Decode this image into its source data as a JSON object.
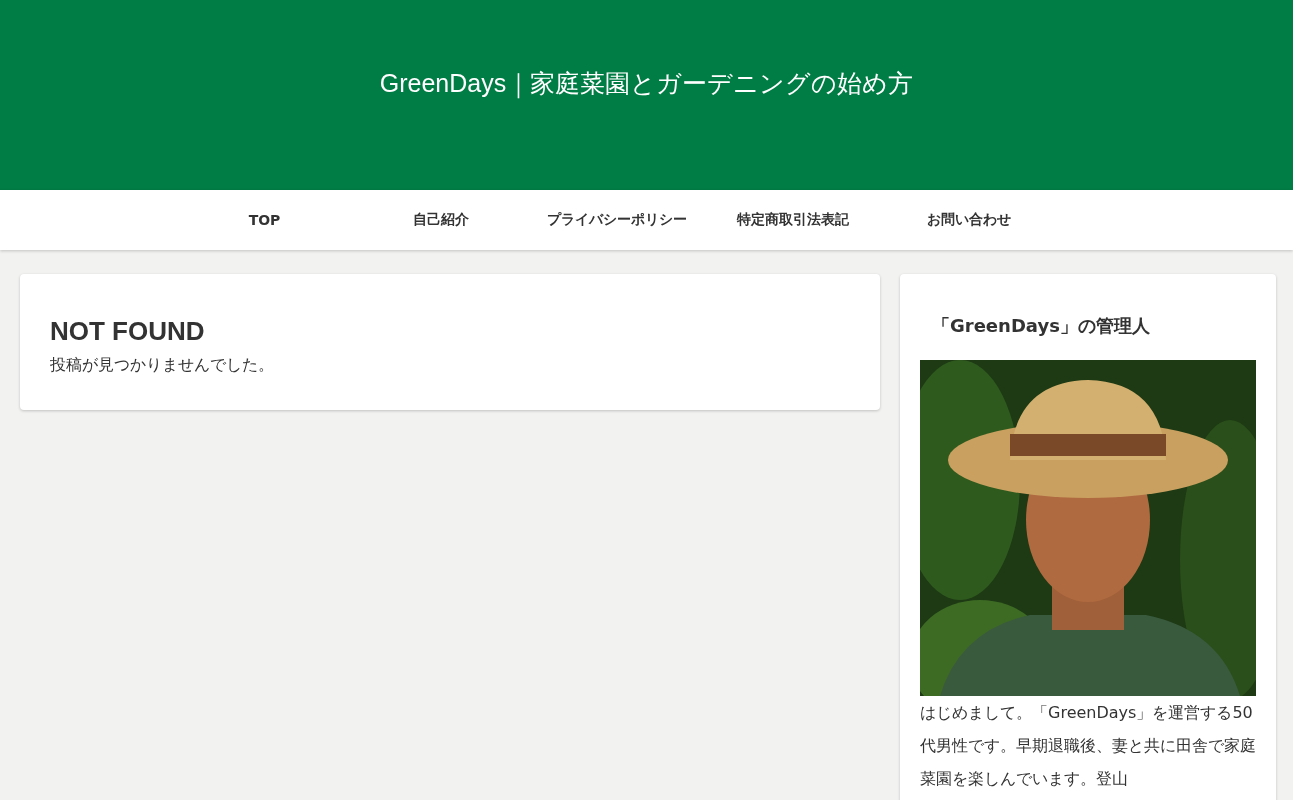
{
  "header": {
    "title": "GreenDays｜家庭菜園とガーデニングの始め方"
  },
  "nav": {
    "items": [
      {
        "label": "TOP"
      },
      {
        "label": "自己紹介"
      },
      {
        "label": "プライバシーポリシー"
      },
      {
        "label": "特定商取引法表記"
      },
      {
        "label": "お問い合わせ"
      }
    ]
  },
  "main": {
    "heading": "NOT FOUND",
    "message": "投稿が見つかりませんでした。"
  },
  "sidebar": {
    "widget_title": "「GreenDays」の管理人",
    "bio": "はじめまして。「GreenDays」を運営する50代男性です。早期退職後、妻と共に田舎で家庭菜園を楽しんでいます。登山"
  }
}
